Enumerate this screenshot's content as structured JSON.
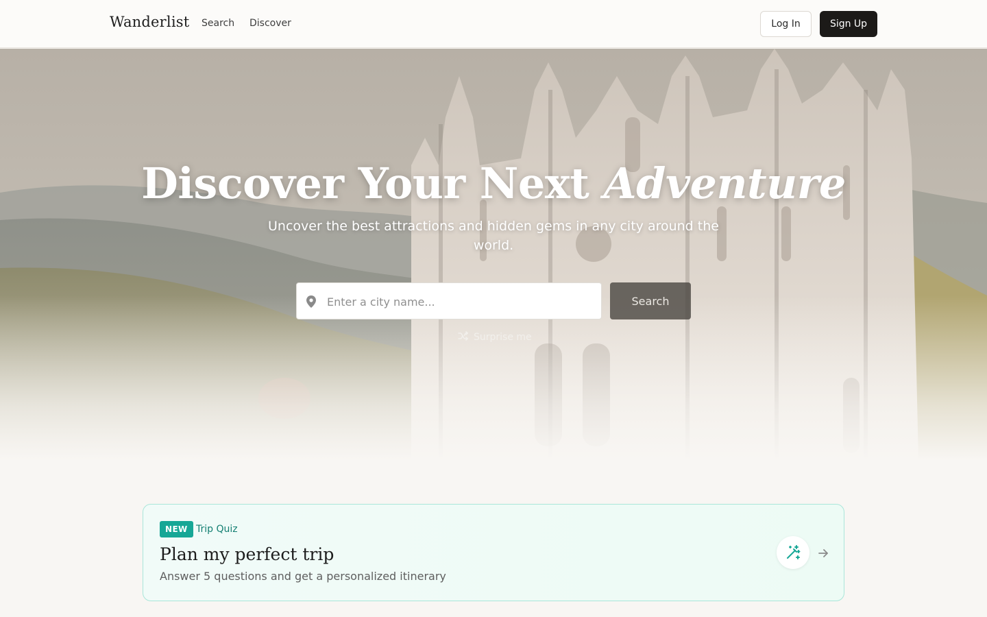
{
  "nav": {
    "brand": "Wanderlist",
    "links": [
      "Search",
      "Discover"
    ],
    "login_label": "Log In",
    "signup_label": "Sign Up"
  },
  "hero": {
    "title_main": "Discover Your Next ",
    "title_accent": "Adventure",
    "subtitle": "Uncover the best attractions and hidden gems in any city around the world.",
    "search_placeholder": "Enter a city name...",
    "search_value": "",
    "search_button": "Search",
    "surprise_label": "Surprise me"
  },
  "quiz": {
    "badge": "NEW",
    "tag": "Trip Quiz",
    "title": "Plan my perfect trip",
    "description": "Answer 5 questions and get a personalized itinerary"
  },
  "icons": [
    "map-pin-icon",
    "shuffle-icon",
    "magic-wand-icon",
    "arrow-right-icon"
  ],
  "colors": {
    "accent": "#17a796",
    "accent_text": "#137f72",
    "card_border": "#a9e6d9",
    "dark_button": "#1c1a18"
  }
}
